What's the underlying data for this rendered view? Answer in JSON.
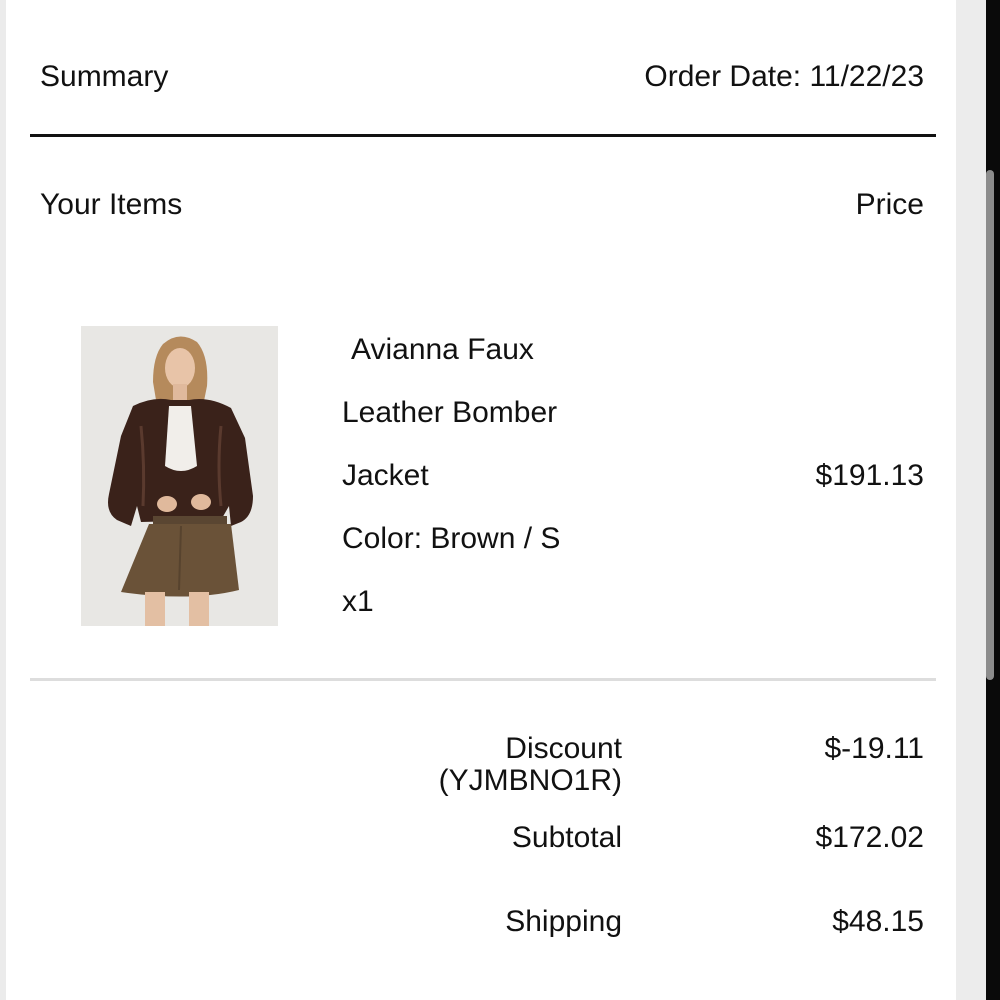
{
  "header": {
    "title": "Summary",
    "order_date": "Order Date: 11/22/23"
  },
  "items_header": {
    "left": "Your Items",
    "right": "Price"
  },
  "item": {
    "name_line1": "Avianna Faux",
    "name_line2": "Leather Bomber",
    "name_line3": "Jacket",
    "variant": "Color: Brown / S",
    "quantity": "x1",
    "price": "$191.13",
    "image_icon": "product-photo"
  },
  "totals": {
    "discount_label": "Discount",
    "discount_code": "(YJMBNO1R)",
    "discount_value": "$-19.11",
    "subtotal_label": "Subtotal",
    "subtotal_value": "$172.02",
    "shipping_label": "Shipping",
    "shipping_value": "$48.15"
  },
  "colors": {
    "divider_dark": "#111111",
    "divider_light": "#dddddd",
    "background": "#ffffff"
  }
}
